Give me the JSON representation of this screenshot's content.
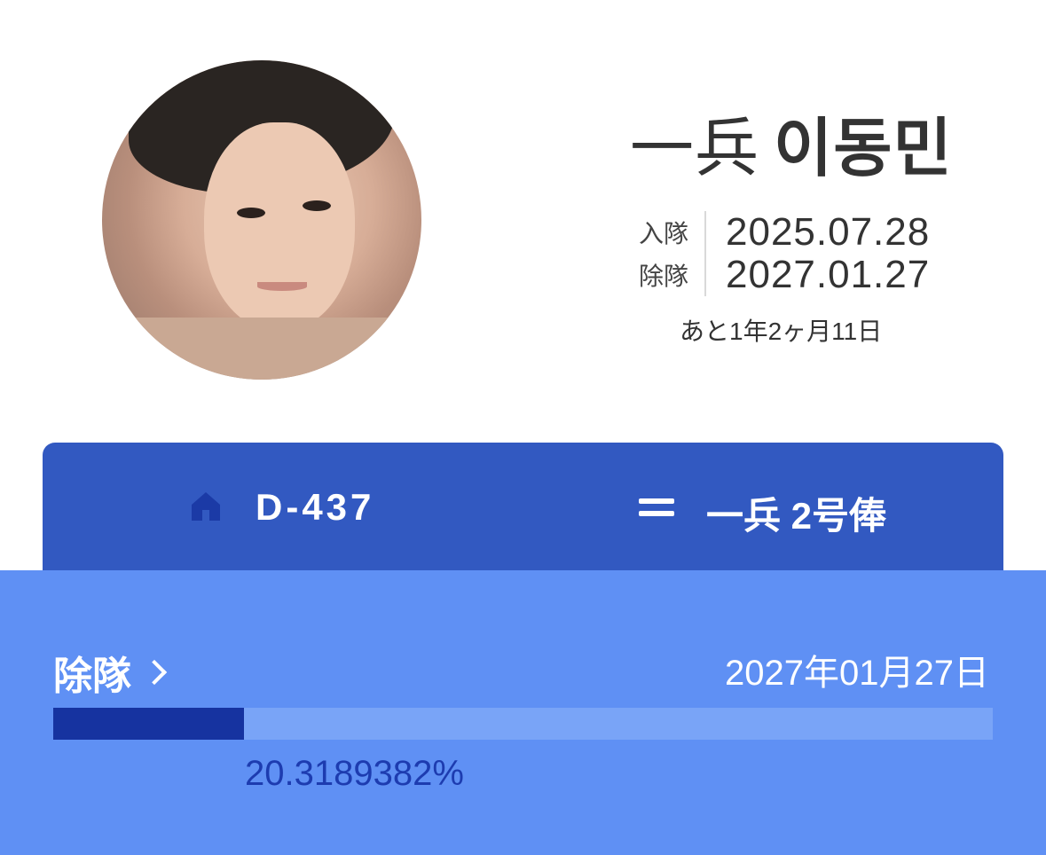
{
  "profile": {
    "rank": "一兵",
    "name": "이동민",
    "enlist_label": "入隊",
    "enlist_date": "2025.07.28",
    "discharge_label": "除隊",
    "discharge_date": "2027.01.27",
    "remaining_text": "あと1年2ヶ月11日"
  },
  "summary_card": {
    "dday": "D-437",
    "rank_pay": "一兵 2号俸",
    "home_icon": "home-icon",
    "equals_icon": "equals-icon"
  },
  "progress_card": {
    "link_label": "除隊",
    "target_date": "2027年01月27日",
    "percent_text": "20.3189382%",
    "progress_fraction": 0.203189382
  },
  "colors": {
    "summary_bg": "#3259c1",
    "progress_bg": "#5f90f4",
    "bar_track": "#79a4f7",
    "bar_fill": "#1633a0",
    "percent_text": "#1d3cb0"
  }
}
